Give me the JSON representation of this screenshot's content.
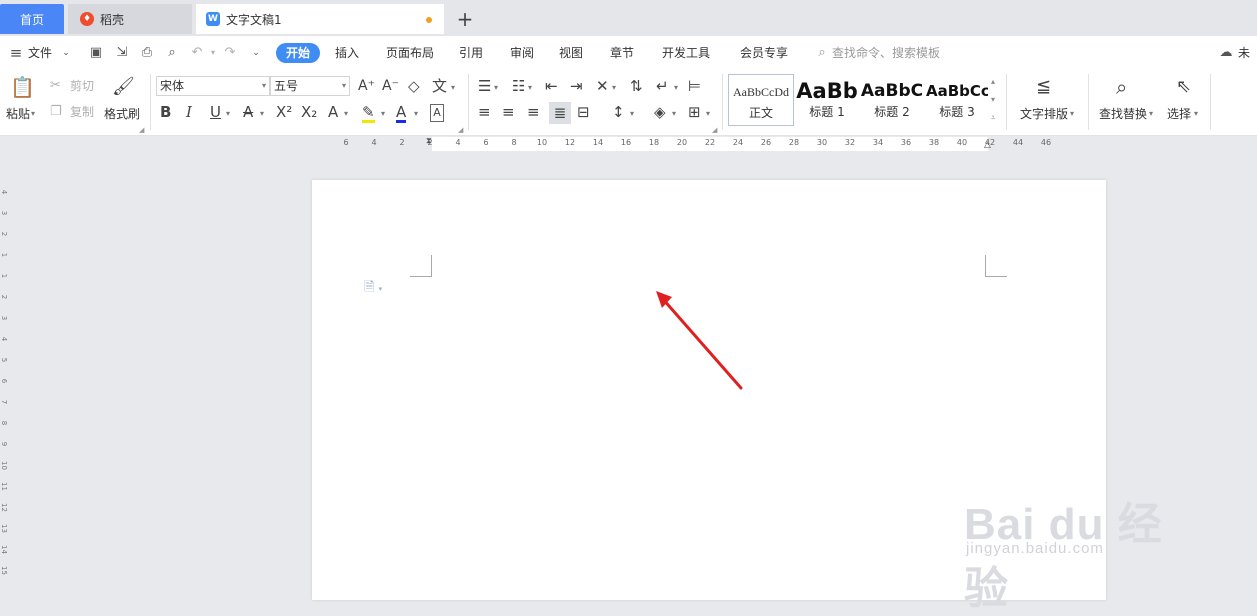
{
  "tabs": {
    "home": "首页",
    "daoke": "稻壳",
    "document": "文字文稿1",
    "new_tab": "+"
  },
  "menu": {
    "file": "文件",
    "start": "开始",
    "insert": "插入",
    "layout": "页面布局",
    "reference": "引用",
    "review": "审阅",
    "view": "视图",
    "section": "章节",
    "devtools": "开发工具",
    "member": "会员专享",
    "search_placeholder": "查找命令、搜索模板",
    "sync": "未同"
  },
  "ribbon": {
    "paste": "粘贴",
    "cut": "剪切",
    "copy": "复制",
    "format_painter": "格式刷",
    "font_name": "宋体",
    "font_size": "五号",
    "styles": [
      {
        "sample": "AaBbCcDd",
        "name": "正文"
      },
      {
        "sample": "AaBb",
        "name": "标题 1"
      },
      {
        "sample": "AaBbC",
        "name": "标题 2"
      },
      {
        "sample": "AaBbCc",
        "name": "标题 3"
      }
    ],
    "text_layout": "文字排版",
    "find_replace": "查找替换",
    "select": "选择"
  },
  "ruler": {
    "ticks": [
      "6",
      "4",
      "2",
      "2",
      "4",
      "6",
      "8",
      "10",
      "12",
      "14",
      "16",
      "18",
      "20",
      "22",
      "24",
      "26",
      "28",
      "30",
      "32",
      "34",
      "36",
      "38",
      "40",
      "42",
      "44",
      "46"
    ]
  },
  "vruler": {
    "ticks": [
      "4",
      "3",
      "2",
      "1",
      "1",
      "2",
      "3",
      "4",
      "5",
      "6",
      "7",
      "8",
      "9",
      "10",
      "11",
      "12",
      "13",
      "14",
      "15"
    ]
  },
  "watermark": {
    "brand": "Bai du 经验",
    "url": "jingyan.baidu.com"
  },
  "colors": {
    "accent": "#3f8cf3",
    "home_tab": "#4a86f6",
    "arrow": "#e02020",
    "unsaved_dot": "#f0a020"
  }
}
